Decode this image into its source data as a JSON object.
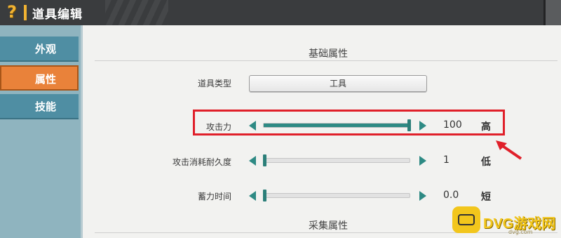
{
  "window": {
    "title": "道具编辑",
    "help_icon": "?"
  },
  "sidebar": {
    "tabs": [
      {
        "label": "外观",
        "active": false
      },
      {
        "label": "属性",
        "active": true
      },
      {
        "label": "技能",
        "active": false
      }
    ]
  },
  "sections": {
    "basic": "基础属性",
    "collect": "采集属性"
  },
  "item_type": {
    "label": "道具类型",
    "value": "工具"
  },
  "rows": [
    {
      "label": "攻击力",
      "value": "100",
      "level": "高",
      "fill_fraction": 1.0
    },
    {
      "label": "攻击消耗耐久度",
      "value": "1",
      "level": "低",
      "fill_fraction": 0.0
    },
    {
      "label": "蓄力时间",
      "value": "0.0",
      "level": "短",
      "fill_fraction": 0.0
    }
  ],
  "watermark": {
    "brand": "DVG游戏网",
    "url": "dvg.com"
  },
  "colors": {
    "accent_teal": "#2e8a84",
    "active_tab": "#e9823a",
    "highlight": "#e0202a"
  }
}
